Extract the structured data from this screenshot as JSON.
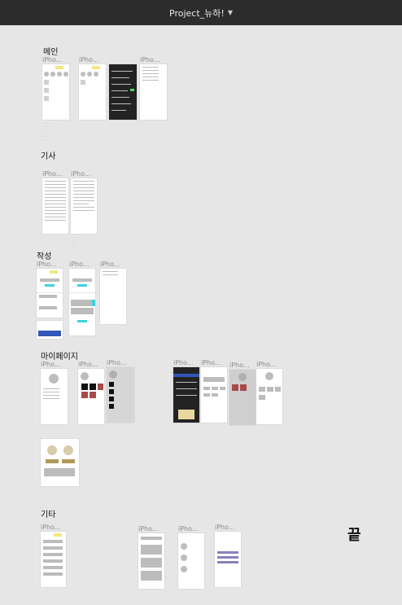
{
  "title": "Project_뉴하!",
  "sections": {
    "main": "메인",
    "article": "기사",
    "compose": "작성",
    "mypage": "마이페이지",
    "etc": "기타"
  },
  "frame_label": "iPho...",
  "end_text": "끝",
  "colors": {
    "toolbar": "#2c2c2c",
    "canvas": "#e6e6e6",
    "accent": "#3ad3dc",
    "highlight": "#f2e783"
  }
}
